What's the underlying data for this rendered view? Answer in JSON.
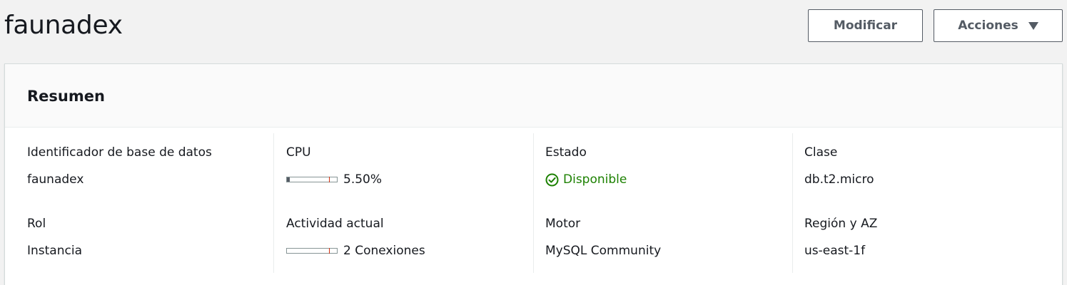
{
  "header": {
    "title": "faunadex",
    "modify_label": "Modificar",
    "actions_label": "Acciones",
    "actions_icon": "caret-down-icon"
  },
  "summary": {
    "title": "Resumen",
    "columns": [
      {
        "fields": [
          {
            "label": "Identificador de base de datos",
            "value": "faunadex"
          },
          {
            "label": "Rol",
            "value": "Instancia"
          }
        ]
      },
      {
        "fields": [
          {
            "label": "CPU",
            "value": "5.50%",
            "meter_fraction": 0.055
          },
          {
            "label": "Actividad actual",
            "value": "2 Conexiones",
            "meter_fraction": 0.0
          }
        ]
      },
      {
        "fields": [
          {
            "label": "Estado",
            "value": "Disponible",
            "status_color": "#1d8102",
            "status_icon": "check-circle-icon"
          },
          {
            "label": "Motor",
            "value": "MySQL Community"
          }
        ]
      },
      {
        "fields": [
          {
            "label": "Clase",
            "value": "db.t2.micro"
          },
          {
            "label": "Región y AZ",
            "value": "us-east-1f"
          }
        ]
      }
    ]
  }
}
